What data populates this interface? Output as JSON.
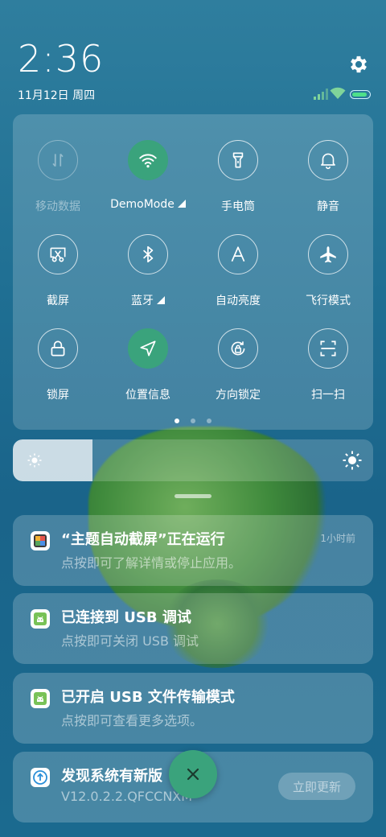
{
  "status_bar": {
    "time": "2:36",
    "date": "11月12日 周四"
  },
  "quick_settings": {
    "tiles": [
      {
        "label": "移动数据",
        "icon": "mobile-data-icon",
        "state": "disabled"
      },
      {
        "label": "DemoMode",
        "icon": "wifi-icon",
        "state": "on",
        "has_arrow": true
      },
      {
        "label": "手电筒",
        "icon": "flashlight-icon",
        "state": "off"
      },
      {
        "label": "静音",
        "icon": "bell-icon",
        "state": "off"
      },
      {
        "label": "截屏",
        "icon": "screenshot-icon",
        "state": "off"
      },
      {
        "label": "蓝牙",
        "icon": "bluetooth-icon",
        "state": "off",
        "has_arrow": true
      },
      {
        "label": "自动亮度",
        "icon": "auto-brightness-icon",
        "state": "off"
      },
      {
        "label": "飞行模式",
        "icon": "airplane-icon",
        "state": "off"
      },
      {
        "label": "锁屏",
        "icon": "lock-icon",
        "state": "off"
      },
      {
        "label": "位置信息",
        "icon": "location-icon",
        "state": "on"
      },
      {
        "label": "方向锁定",
        "icon": "rotation-lock-icon",
        "state": "off"
      },
      {
        "label": "扫一扫",
        "icon": "scan-icon",
        "state": "off"
      }
    ],
    "page_count": 3,
    "active_page": 1
  },
  "brightness": {
    "level": 0.22
  },
  "notifications": [
    {
      "title": "“主题自动截屏”正在运行",
      "subtitle": "点按即可了解详情或停止应用。",
      "time": "1小时前",
      "icon": "theme-app-icon"
    },
    {
      "title": "已连接到 USB 调试",
      "subtitle": "点按即可关闭 USB 调试",
      "icon": "android-icon"
    },
    {
      "title": "已开启 USB 文件传输模式",
      "subtitle": "点按即可查看更多选项。",
      "icon": "android-icon"
    },
    {
      "title": "发现系统有新版",
      "subtitle": "V12.0.2.2.QFCCNXM",
      "action": "立即更新",
      "icon": "update-icon"
    }
  ],
  "colors": {
    "accent": "#3aa37c"
  }
}
